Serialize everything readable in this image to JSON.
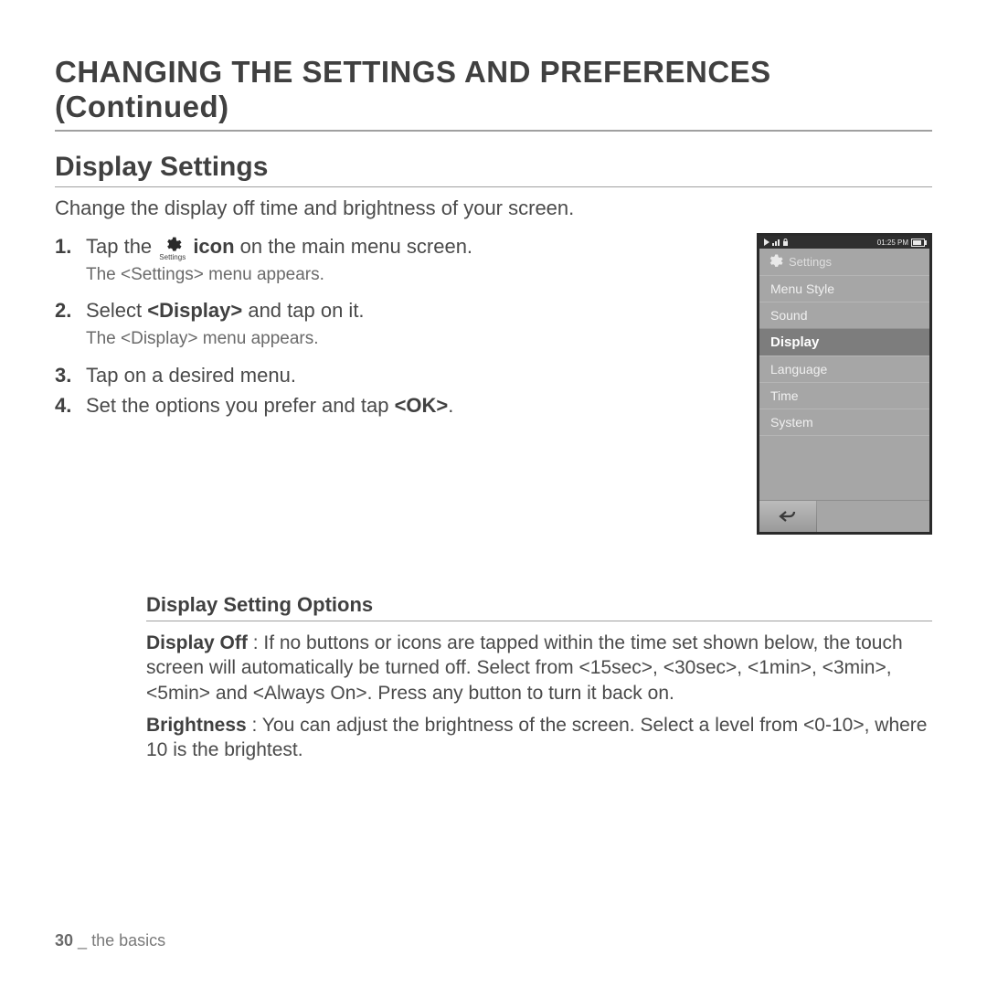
{
  "page": {
    "title": "CHANGING THE SETTINGS AND PREFERENCES (Continued)",
    "section_title": "Display Settings",
    "intro": "Change the display off time and brightness of your screen.",
    "subsection_title": "Display Setting Options",
    "page_number": "30",
    "footer_section": "the basics"
  },
  "steps": {
    "s1_a": "Tap the ",
    "s1_b_bold": " icon",
    "s1_c": " on the main menu screen.",
    "s1_sub": "The <Settings> menu appears.",
    "s2_a": "Select ",
    "s2_b_bold": "<Display>",
    "s2_c": " and tap on it.",
    "s2_sub": "The <Display> menu appears.",
    "s3": "Tap on a desired menu.",
    "s4_a": "Set the options you prefer and tap ",
    "s4_b_bold": "<OK>",
    "s4_c": "."
  },
  "icon": {
    "label": "Settings"
  },
  "device": {
    "time": "01:25 PM",
    "header": "Settings",
    "menu": [
      "Menu Style",
      "Sound",
      "Display",
      "Language",
      "Time",
      "System"
    ],
    "selected_index": 2
  },
  "options": {
    "display_off_label": "Display Off",
    "display_off_text": " : If no buttons or icons are tapped within the time set shown below, the touch screen will automatically be turned off. Select from <15sec>, <30sec>, <1min>, <3min>, <5min> and <Always On>. Press any button to turn it back on.",
    "brightness_label": "Brightness",
    "brightness_text": " : You can adjust the brightness of the screen. Select a level from <0-10>, where 10 is the brightest."
  }
}
